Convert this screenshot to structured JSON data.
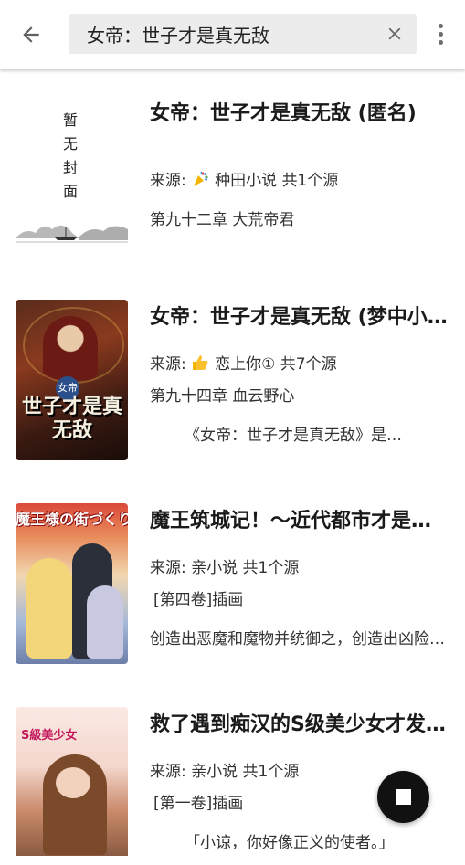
{
  "search": {
    "query": "女帝：世子才是真无敌"
  },
  "icons": {
    "back": "arrow-left-icon",
    "clear": "close-icon",
    "more": "more-vert-icon",
    "stop": "stop-icon"
  },
  "results": [
    {
      "title": "女帝：世子才是真无敌 (匿名)",
      "source_prefix": "来源:",
      "source_name": "种田小说",
      "source_count": "共1个源",
      "chapter": "第九十二章 大荒帝君",
      "intro": "",
      "cover_text": "暂无封面",
      "emoji": "party-popper-icon"
    },
    {
      "title": "女帝：世子才是真无敌 (梦中小猪)",
      "source_prefix": "来源:",
      "source_name": "恋上你①",
      "source_count": "共7个源",
      "chapter": "第九十四章 血云野心",
      "intro": "《女帝：世子才是真无敌》是梦中小猪",
      "cover_text": "世子才是真无敌",
      "cover_small": "女帝",
      "emoji": "thumbs-up-icon"
    },
    {
      "title": "魔王筑城记！～近代都市才是魔王城",
      "source_prefix": "来源:",
      "source_name": "亲小说",
      "source_count": "共1个源",
      "chapter": "[第四卷]插画",
      "intro": "创造出恶魔和魔物并统御之，创造出凶险的迷宫",
      "cover_text": "魔王様の街づくり!"
    },
    {
      "title": "救了遇到痴汉的S级美少女才发现是邻座的青梅竹马",
      "source_prefix": "来源:",
      "source_name": "亲小说",
      "source_count": "共1个源",
      "chapter": "[第一卷]插画",
      "intro": "「小谅，你好像正义的使者。」",
      "cover_text": "S級美少女"
    }
  ]
}
